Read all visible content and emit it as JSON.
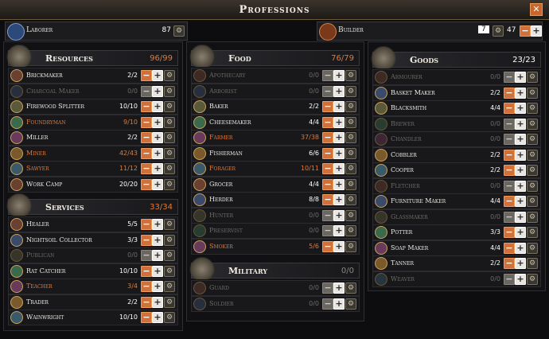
{
  "window": {
    "title": "Professions"
  },
  "laborer": {
    "label": "Laborer",
    "count": "87"
  },
  "builder": {
    "label": "Builder",
    "count": "7",
    "total": "47"
  },
  "sections": [
    {
      "key": "resources",
      "title": "Resources",
      "count": "96/99",
      "count_color": "#e07a3a",
      "rows": [
        {
          "label": "Brickmaker",
          "count": "2/2",
          "state": "normal"
        },
        {
          "label": "Charcoal Maker",
          "count": "0/0",
          "state": "dim"
        },
        {
          "label": "Firewood Splitter",
          "count": "10/10",
          "state": "normal"
        },
        {
          "label": "Foundryman",
          "count": "9/10",
          "state": "orange"
        },
        {
          "label": "Miller",
          "count": "2/2",
          "state": "normal"
        },
        {
          "label": "Miner",
          "count": "42/43",
          "state": "orange"
        },
        {
          "label": "Sawyer",
          "count": "11/12",
          "state": "orange"
        },
        {
          "label": "Work Camp",
          "count": "20/20",
          "state": "normal"
        }
      ]
    },
    {
      "key": "services",
      "title": "Services",
      "count": "33/34",
      "count_color": "#e07a3a",
      "rows": [
        {
          "label": "Healer",
          "count": "5/5",
          "state": "normal"
        },
        {
          "label": "Nightsoil Collector",
          "count": "3/3",
          "state": "normal"
        },
        {
          "label": "Publican",
          "count": "0/0",
          "state": "dim"
        },
        {
          "label": "Rat Catcher",
          "count": "10/10",
          "state": "normal"
        },
        {
          "label": "Teacher",
          "count": "3/4",
          "state": "orange"
        },
        {
          "label": "Trader",
          "count": "2/2",
          "state": "normal"
        },
        {
          "label": "Wainwright",
          "count": "10/10",
          "state": "normal"
        }
      ]
    },
    {
      "key": "food",
      "title": "Food",
      "count": "76/79",
      "count_color": "#e07a3a",
      "rows": [
        {
          "label": "Apothecary",
          "count": "0/0",
          "state": "dim"
        },
        {
          "label": "Arborist",
          "count": "0/0",
          "state": "dim"
        },
        {
          "label": "Baker",
          "count": "2/2",
          "state": "normal"
        },
        {
          "label": "Cheesemaker",
          "count": "4/4",
          "state": "normal"
        },
        {
          "label": "Farmer",
          "count": "37/38",
          "state": "orange"
        },
        {
          "label": "Fisherman",
          "count": "6/6",
          "state": "normal"
        },
        {
          "label": "Forager",
          "count": "10/11",
          "state": "orange"
        },
        {
          "label": "Grocer",
          "count": "4/4",
          "state": "normal"
        },
        {
          "label": "Herder",
          "count": "8/8",
          "state": "normal"
        },
        {
          "label": "Hunter",
          "count": "0/0",
          "state": "dim"
        },
        {
          "label": "Preservist",
          "count": "0/0",
          "state": "dim"
        },
        {
          "label": "Smoker",
          "count": "5/6",
          "state": "orange"
        }
      ]
    },
    {
      "key": "military",
      "title": "Military",
      "count": "0/0",
      "count_color": "#8a8780",
      "rows": [
        {
          "label": "Guard",
          "count": "0/0",
          "state": "dim"
        },
        {
          "label": "Soldier",
          "count": "0/0",
          "state": "dim"
        }
      ]
    },
    {
      "key": "goods",
      "title": "Goods",
      "count": "23/23",
      "count_color": "#ffffff",
      "rows": [
        {
          "label": "Armourer",
          "count": "0/0",
          "state": "dim"
        },
        {
          "label": "Basket Maker",
          "count": "2/2",
          "state": "normal"
        },
        {
          "label": "Blacksmith",
          "count": "4/4",
          "state": "normal"
        },
        {
          "label": "Brewer",
          "count": "0/0",
          "state": "dim"
        },
        {
          "label": "Chandler",
          "count": "0/0",
          "state": "dim"
        },
        {
          "label": "Cobbler",
          "count": "2/2",
          "state": "normal"
        },
        {
          "label": "Cooper",
          "count": "2/2",
          "state": "normal"
        },
        {
          "label": "Fletcher",
          "count": "0/0",
          "state": "dim"
        },
        {
          "label": "Furniture Maker",
          "count": "4/4",
          "state": "normal"
        },
        {
          "label": "Glassmaker",
          "count": "0/0",
          "state": "dim"
        },
        {
          "label": "Potter",
          "count": "3/3",
          "state": "normal"
        },
        {
          "label": "Soap Maker",
          "count": "4/4",
          "state": "normal"
        },
        {
          "label": "Tanner",
          "count": "2/2",
          "state": "normal"
        },
        {
          "label": "Weaver",
          "count": "0/0",
          "state": "dim"
        }
      ]
    }
  ],
  "icons": {
    "close": "close-icon",
    "gear": "gear-icon",
    "minus": "minus-icon",
    "plus": "plus-icon"
  }
}
